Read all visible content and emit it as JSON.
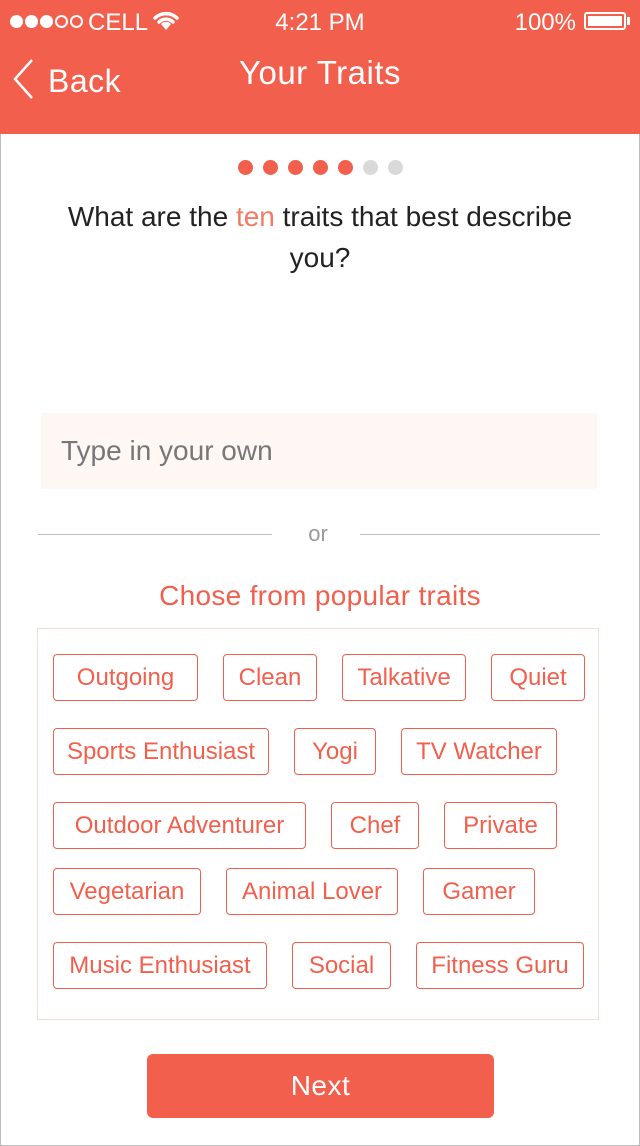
{
  "status_bar": {
    "carrier": "CELL",
    "time": "4:21 PM",
    "battery": "100%"
  },
  "nav": {
    "back_label": "Back",
    "title": "Your Traits"
  },
  "progress": {
    "total": 7,
    "current": 5
  },
  "question": {
    "prefix": "What are the ",
    "highlight": "ten",
    "suffix": " traits that best describe you?"
  },
  "custom_input": {
    "placeholder": "Type in your own",
    "value": ""
  },
  "divider_text": "or",
  "popular": {
    "title": "Chose from popular traits",
    "traits": [
      "Outgoing",
      "Clean",
      "Talkative",
      "Quiet",
      "Sports Enthusiast",
      "Yogi",
      "TV Watcher",
      "Outdoor Adventurer",
      "Chef",
      "Private",
      "Vegetarian",
      "Animal Lover",
      "Gamer",
      "Music Enthusiast",
      "Social",
      "Fitness Guru"
    ]
  },
  "next_label": "Next",
  "colors": {
    "accent": "#f25f4c",
    "accent_light": "#f47a66",
    "input_bg": "#fef7f4"
  }
}
